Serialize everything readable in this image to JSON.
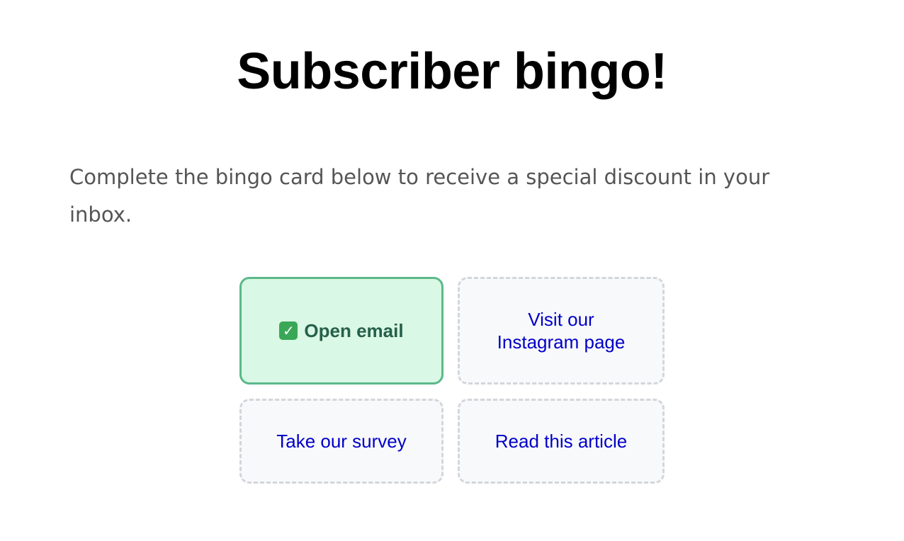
{
  "page": {
    "title": "Subscriber bingo!",
    "intro": "Complete the bingo card below to receive a special discount in your inbox."
  },
  "bingo": {
    "tiles": [
      {
        "label": "Open email",
        "completed": true,
        "icon": "check-mark-icon"
      },
      {
        "label": "Visit our Instagram page",
        "completed": false
      },
      {
        "label": "Take our survey",
        "completed": false
      },
      {
        "label": "Read this article",
        "completed": false
      }
    ],
    "colors": {
      "completed_bg": "#d9f8e5",
      "completed_border": "#5cb88a",
      "completed_text": "#26604a",
      "todo_bg": "#f8f9fb",
      "todo_border": "#d4d6da",
      "link_text": "#0000c8"
    }
  }
}
